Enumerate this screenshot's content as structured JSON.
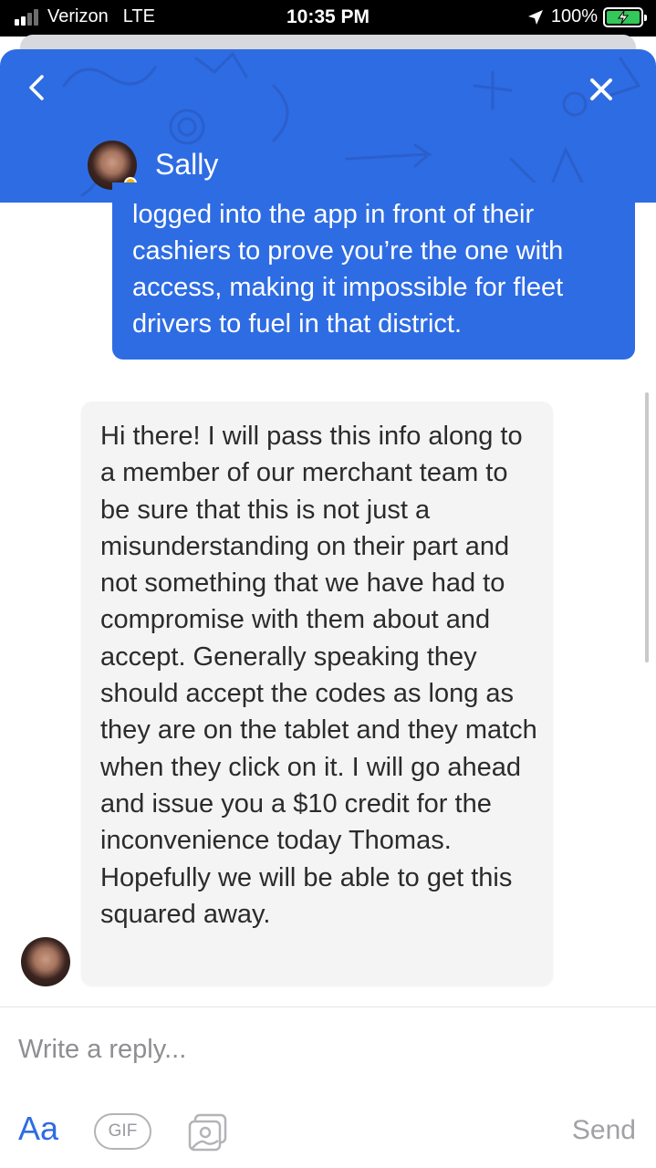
{
  "status_bar": {
    "carrier": "Verizon",
    "network": "LTE",
    "time": "10:35 PM",
    "battery": "100%"
  },
  "header": {
    "agent_name": "Sally",
    "back_icon": "chevron-left-icon",
    "close_icon": "close-icon",
    "presence_color": "#f5b800",
    "brand_color": "#2e6ce3"
  },
  "messages": [
    {
      "from": "user",
      "text": "logged into the app in front of their cashiers to prove you’re the one with access, making it impossible for fleet drivers to fuel in that district."
    },
    {
      "from": "agent",
      "text": "Hi there! I will pass this info along to a member of our merchant team to be sure that this is not just a misunderstanding on their part and not something that we have had to compromise with them about and accept. Generally speaking they should accept the codes as long as they are on the tablet and they match when they click on it. I will go ahead and issue you a $10 credit for the inconvenience today Thomas. Hopefully we will be able to get this squared away."
    }
  ],
  "composer": {
    "placeholder": "Write a reply...",
    "aa_label": "Aa",
    "gif_label": "GIF",
    "image_icon": "image-icon",
    "send_label": "Send"
  }
}
